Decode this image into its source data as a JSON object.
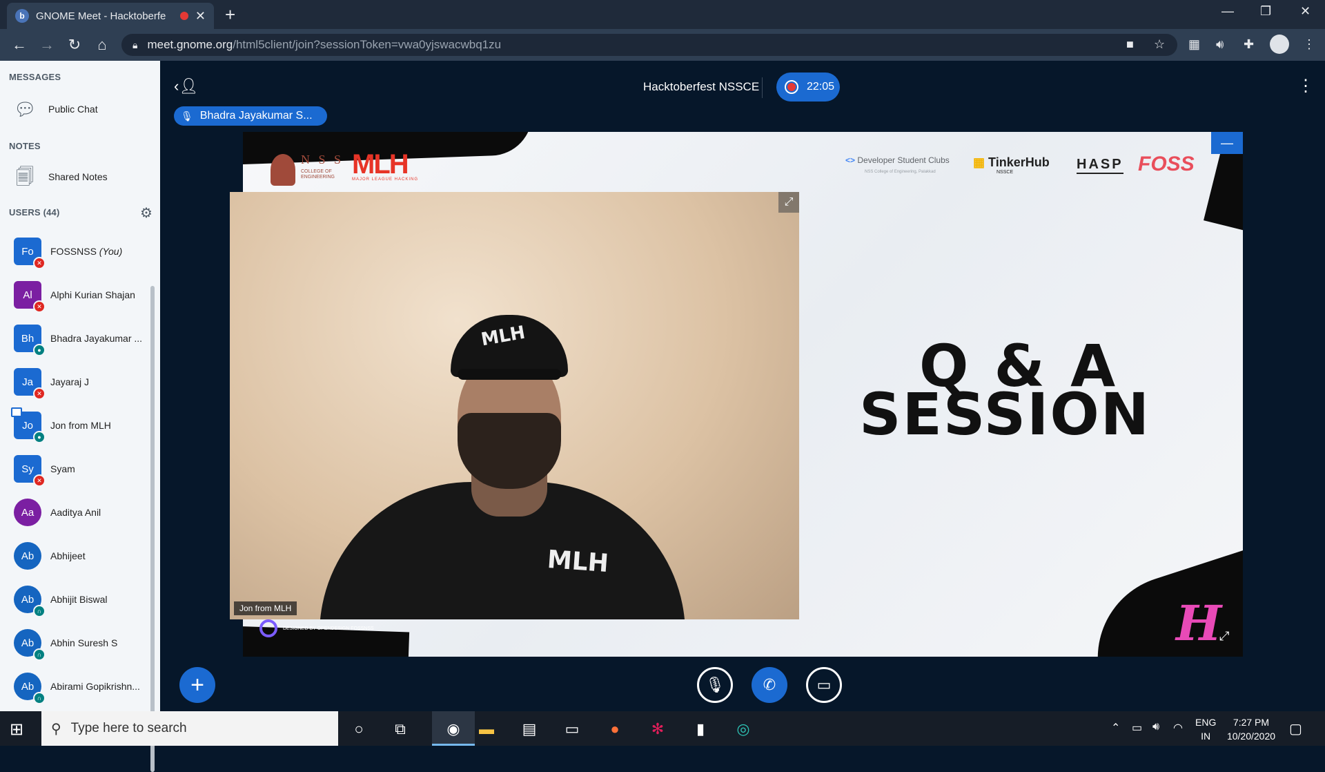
{
  "browser": {
    "tab_title": "GNOME Meet - Hacktoberfe",
    "tab_favicon": "b",
    "url_host": "meet.gnome.org",
    "url_path": "/html5client/join?sessionToken=vwa0yjswacwbq1zu"
  },
  "sidebar": {
    "messages_label": "MESSAGES",
    "public_chat_label": "Public Chat",
    "notes_label": "NOTES",
    "shared_notes_label": "Shared Notes",
    "users_label": "USERS (44)",
    "users": [
      {
        "initials": "Fo",
        "name": "FOSSNSS",
        "you": "(You)",
        "color": "#1b6ad1",
        "shape": "square",
        "status": "muted"
      },
      {
        "initials": "Al",
        "name": "Alphi Kurian Shajan",
        "color": "#7b1fa2",
        "shape": "square",
        "status": "muted"
      },
      {
        "initials": "Bh",
        "name": "Bhadra Jayakumar ...",
        "color": "#1b6ad1",
        "shape": "square",
        "status": "listen"
      },
      {
        "initials": "Ja",
        "name": "Jayaraj J",
        "color": "#1b6ad1",
        "shape": "square",
        "status": "muted"
      },
      {
        "initials": "Jo",
        "name": "Jon from MLH",
        "color": "#1b6ad1",
        "shape": "square",
        "status": "listen"
      },
      {
        "initials": "Sy",
        "name": "Syam",
        "color": "#1b6ad1",
        "shape": "square",
        "status": "muted"
      },
      {
        "initials": "Aa",
        "name": "Aaditya Anil",
        "color": "#7b1fa2",
        "shape": "round",
        "status": "none"
      },
      {
        "initials": "Ab",
        "name": "Abhijeet",
        "color": "#1565c0",
        "shape": "round",
        "status": "none"
      },
      {
        "initials": "Ab",
        "name": "Abhijit Biswal",
        "color": "#1565c0",
        "shape": "round",
        "status": "listen"
      },
      {
        "initials": "Ab",
        "name": "Abhin Suresh S",
        "color": "#1565c0",
        "shape": "round",
        "status": "listen"
      },
      {
        "initials": "Ab",
        "name": "Abirami Gopikrishn...",
        "color": "#1565c0",
        "shape": "round",
        "status": "listen"
      }
    ]
  },
  "meeting": {
    "title": "Hacktoberfest NSSCE",
    "recording_time": "22:05",
    "talking_indicator": "Bhadra Jayakumar S...",
    "webcam_name": "Jon from MLH",
    "cap_logo": "MLH",
    "shirt_logo": "MLH"
  },
  "slide": {
    "nss_text": "N S S",
    "nss_sub": "COLLEGE OF ENGINEERING",
    "mlh_text": "MLH",
    "mlh_sub": "MAJOR LEAGUE HACKING",
    "dsc_text": "Developer Student Clubs",
    "dsc_sub": "NSS College of Engineering, Palakkad",
    "tinkerhub_text": "TinkerHub",
    "tinkerhub_sub": "NSSCE",
    "hasp_text": "HASP",
    "foss_text": "FOSS",
    "line1": "Q & A",
    "line2": "SESSION",
    "footer": "DESIGNED BY OPENDESIGN FOSSNSS",
    "corner_mark": "H"
  },
  "taskbar": {
    "search_placeholder": "Type here to search",
    "lang_top": "ENG",
    "lang_bottom": "IN",
    "time": "7:27 PM",
    "date": "10/20/2020"
  },
  "colors": {
    "accent": "#1b6ad1",
    "muted": "#df2721",
    "listen": "#008081",
    "bg": "#06172a"
  }
}
